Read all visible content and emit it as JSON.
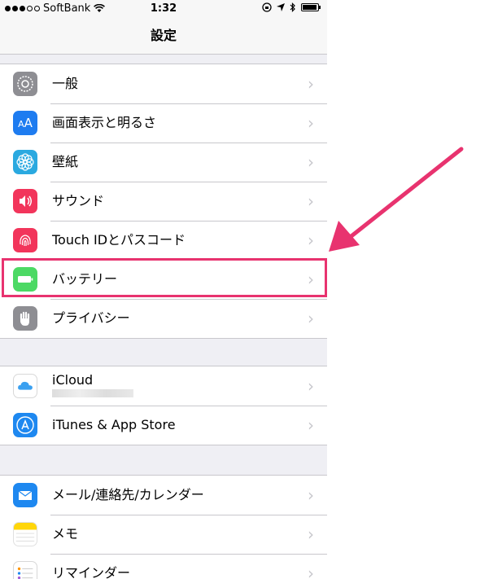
{
  "status_bar": {
    "carrier": "SoftBank",
    "time": "1:32"
  },
  "nav": {
    "title": "設定"
  },
  "groups": [
    {
      "items": [
        {
          "icon": "gear-icon",
          "label": "一般",
          "color": "#8e8e93"
        },
        {
          "icon": "display-brightness-icon",
          "label": "画面表示と明るさ",
          "color": "#1e7cf0"
        },
        {
          "icon": "wallpaper-flower-icon",
          "label": "壁紙",
          "color": "#2aa9e0"
        },
        {
          "icon": "speaker-icon",
          "label": "サウンド",
          "color": "#f2355b"
        },
        {
          "icon": "fingerprint-icon",
          "label": "Touch IDとパスコード",
          "color": "#f2355b"
        },
        {
          "icon": "battery-icon",
          "label": "バッテリー",
          "color": "#4cd964"
        },
        {
          "icon": "hand-icon",
          "label": "プライバシー",
          "color": "#8e8e93"
        }
      ]
    },
    {
      "items": [
        {
          "icon": "icloud-icon",
          "label": "iCloud",
          "color": "#ffffff"
        },
        {
          "icon": "app-store-icon",
          "label": "iTunes & App Store",
          "color": "#1e88f0"
        }
      ]
    },
    {
      "items": [
        {
          "icon": "mail-icon",
          "label": "メール/連絡先/カレンダー",
          "color": "#1e88f0"
        },
        {
          "icon": "notes-icon",
          "label": "メモ",
          "color": "#ffd60a"
        },
        {
          "icon": "reminders-icon",
          "label": "リマインダー",
          "color": "#ffffff"
        }
      ]
    }
  ],
  "annotation": {
    "color": "#e8336f",
    "target": "バッテリー"
  }
}
